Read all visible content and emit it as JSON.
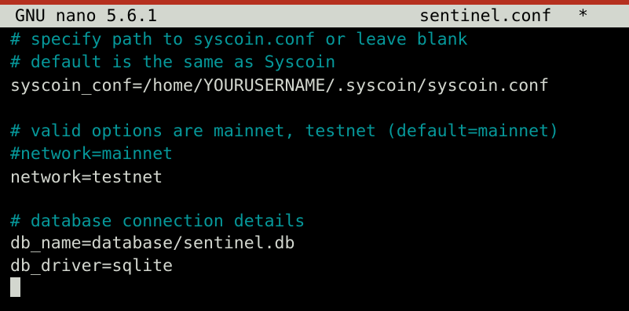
{
  "titlebar": {
    "app": "GNU nano 5.6.1",
    "filename": "sentinel.conf",
    "modified_marker": "*"
  },
  "lines": [
    "# specify path to syscoin.conf or leave blank",
    "# default is the same as Syscoin",
    "syscoin_conf=/home/YOURUSERNAME/.syscoin/syscoin.conf",
    "",
    "# valid options are mainnet, testnet (default=mainnet)",
    "#network=mainnet",
    "network=testnet",
    "",
    "# database connection details",
    "db_name=database/sentinel.db",
    "db_driver=sqlite"
  ],
  "colors": {
    "comment": "#06989a",
    "text": "#d3d7cf",
    "title_bar": "#d3d7cf",
    "background": "#000000",
    "window_accent": "#b5301f"
  }
}
